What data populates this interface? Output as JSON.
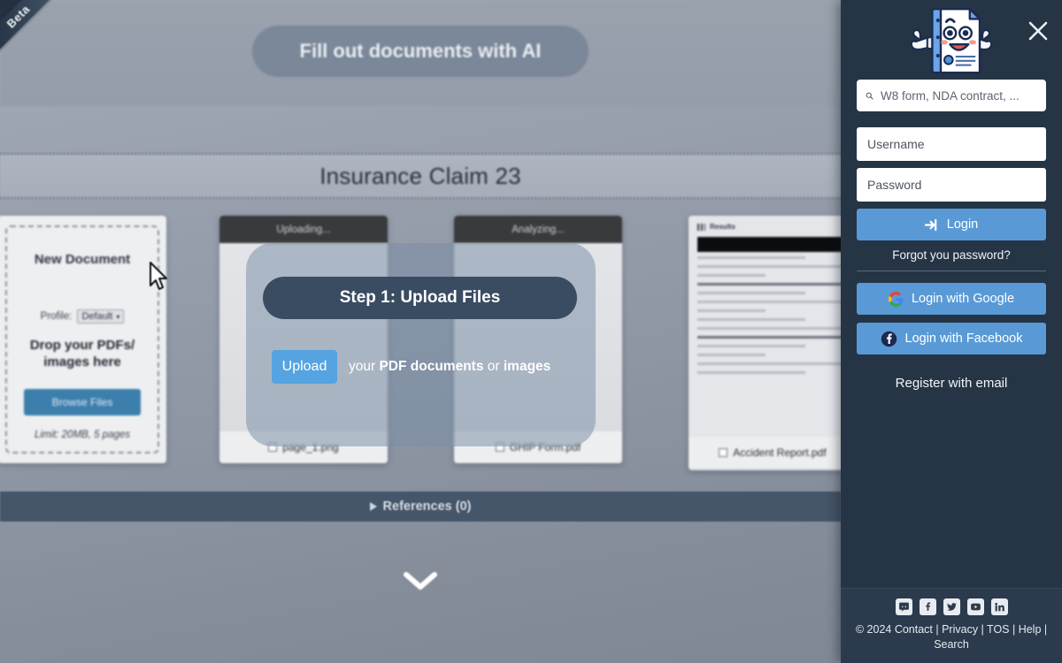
{
  "app": {
    "beta_badge": "Beta",
    "hero_title": "Fill out documents with AI",
    "document_title": "Insurance Claim 23"
  },
  "new_document_card": {
    "title": "New Document",
    "profile_label": "Profile:",
    "profile_value": "Default",
    "caret_icon": "chevron-down-icon",
    "drop_text": "Drop your PDFs/ images here",
    "browse_button": "Browse Files",
    "limit_text": "Limit: 20MB, 5 pages"
  },
  "upload_cards": [
    {
      "status": "Uploading...",
      "filename": "page_1.png"
    },
    {
      "status": "Analyzing...",
      "filename": "GHIP Form.pdf"
    },
    {
      "status": "Results",
      "filename": "Accident Report.pdf"
    }
  ],
  "references": {
    "label": "References (0)",
    "expand_icon": "triangle-right-icon"
  },
  "scroll_hint": {
    "icon": "chevron-down-icon"
  },
  "tooltip": {
    "step_title": "Step 1: Upload Files",
    "upload_button": "Upload",
    "desc_prefix": "your ",
    "desc_bold_1": "PDF documents",
    "desc_mid": " or ",
    "desc_bold_2": "images"
  },
  "sidebar": {
    "logo_icon": "document-mascot-icon",
    "close_icon": "close-icon",
    "search": {
      "icon": "search-icon",
      "placeholder": "W8 form, NDA contract, ...",
      "value": ""
    },
    "login": {
      "username_placeholder": "Username",
      "username_value": "",
      "password_placeholder": "Password",
      "password_value": "",
      "login_button": "Login",
      "login_icon": "sign-in-icon",
      "forgot_link": "Forgot you password?",
      "google_button": "Login with Google",
      "google_icon": "google-icon",
      "facebook_button": "Login with Facebook",
      "facebook_icon": "facebook-icon",
      "register_link": "Register with email"
    },
    "footer": {
      "social_icons": [
        "discord-icon",
        "facebook-icon",
        "twitter-icon",
        "youtube-icon",
        "linkedin-icon"
      ],
      "copyright": "© 2024 Contact | Privacy | TOS | Help | Search"
    }
  },
  "colors": {
    "sidebar_bg": "#253545",
    "accent_blue": "#599ad6",
    "tooltip_pill": "#3a4c62",
    "refs_bar": "#45556a",
    "page_bg": "#8e96a4"
  }
}
